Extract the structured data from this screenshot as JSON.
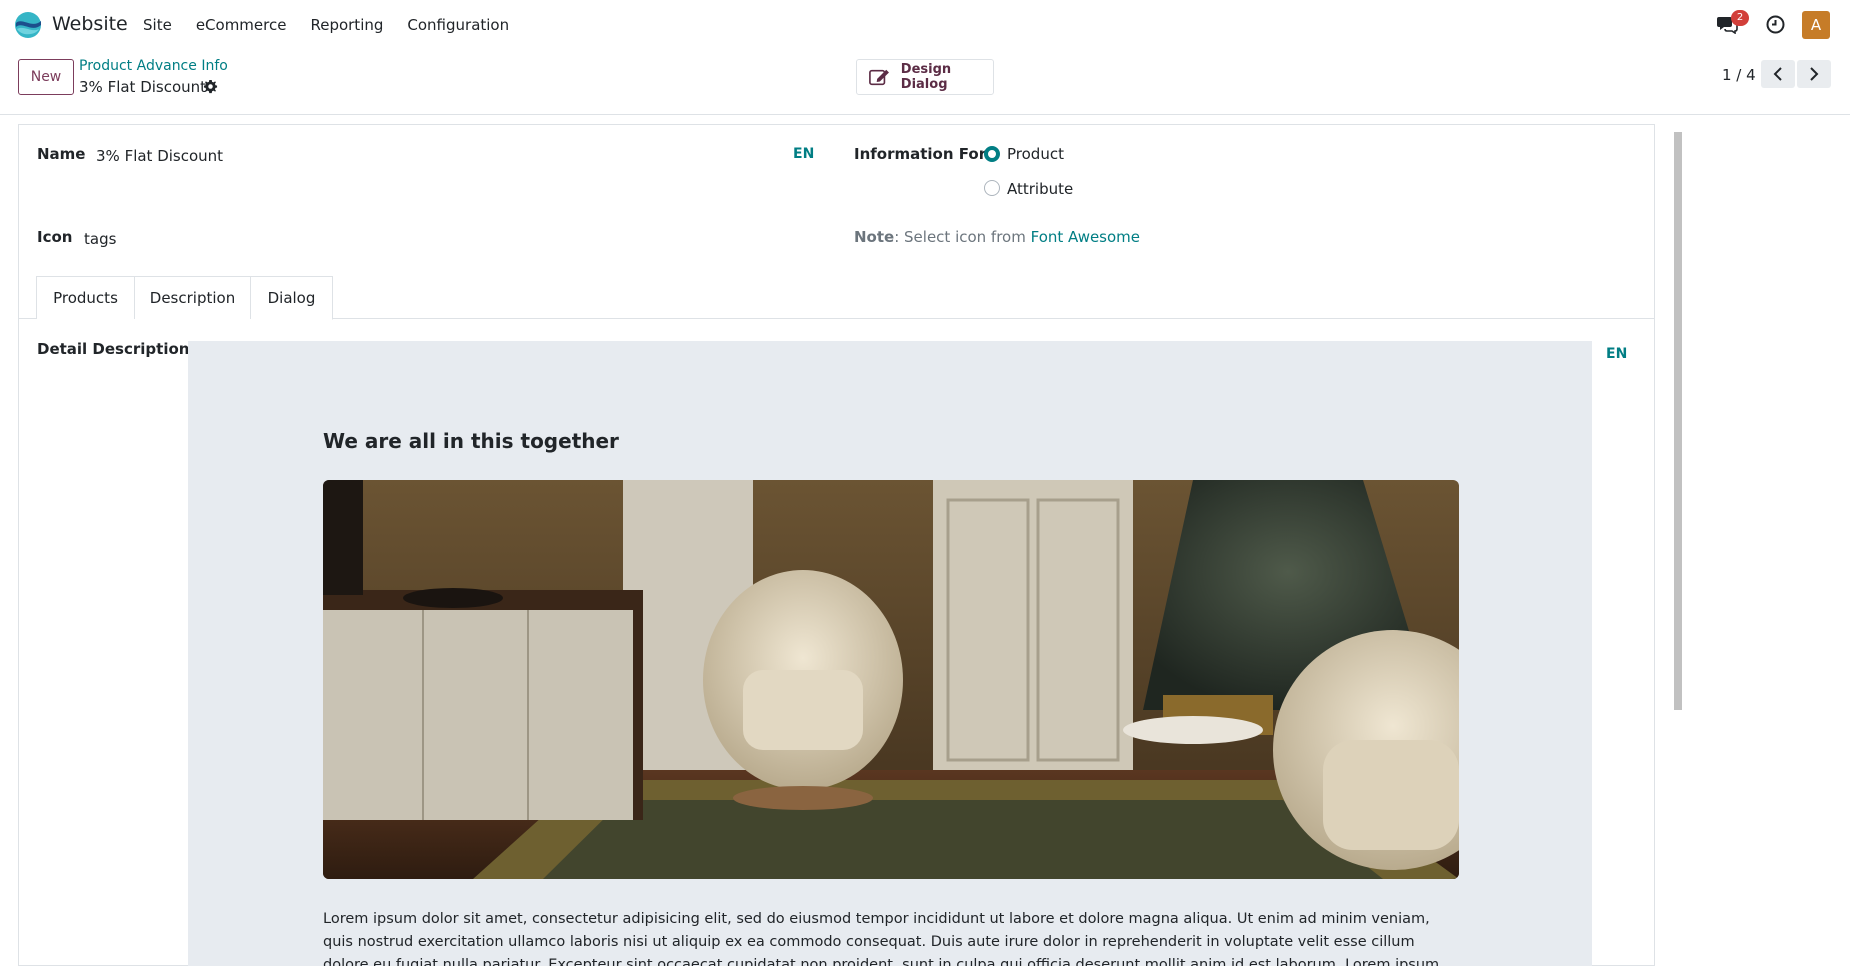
{
  "navbar": {
    "app_name": "Website",
    "menu": [
      "Site",
      "eCommerce",
      "Reporting",
      "Configuration"
    ],
    "chat_badge": "2",
    "avatar_letter": "A"
  },
  "control": {
    "new_label": "New",
    "breadcrumb": "Product Advance Info",
    "record_name": "3% Flat Discount",
    "design_label": "Design Dialog",
    "pager": "1 / 4"
  },
  "form": {
    "name_label": "Name",
    "name_value": "3% Flat Discount",
    "lang": "EN",
    "info_for_label": "Information For",
    "radio_product": "Product",
    "radio_attribute": "Attribute",
    "radio_selected": "Product",
    "icon_label": "Icon",
    "icon_value": "tags",
    "note_bold": "Note",
    "note_text": ": Select icon from ",
    "note_link": "Font Awesome"
  },
  "tabs": [
    "Products",
    "Description",
    "Dialog"
  ],
  "active_tab": "Dialog",
  "detail": {
    "label": "Detail Description",
    "lang": "EN",
    "heading": "We are all in this together",
    "body": "Lorem ipsum dolor sit amet, consectetur adipisicing elit, sed do eiusmod tempor incididunt ut labore et dolore magna aliqua. Ut enim ad minim veniam, quis nostrud exercitation ullamco laboris nisi ut aliquip ex ea commodo consequat. Duis aute irure dolor in reprehenderit in voluptate velit esse cillum dolore eu fugiat nulla pariatur. Excepteur sint occaecat cupidatat non proident, sunt in culpa qui officia deserunt mollit anim id est laborum. Lorem ipsum dolor sit amet."
  },
  "colors": {
    "accent": "#017e84",
    "brand": "#7c3d5c",
    "panel_bg": "#e7ebf0"
  },
  "icons": [
    "logo-icon",
    "chat-icon",
    "clock-icon",
    "gear-icon",
    "edit-icon",
    "chevron-left-icon",
    "chevron-right-icon"
  ]
}
